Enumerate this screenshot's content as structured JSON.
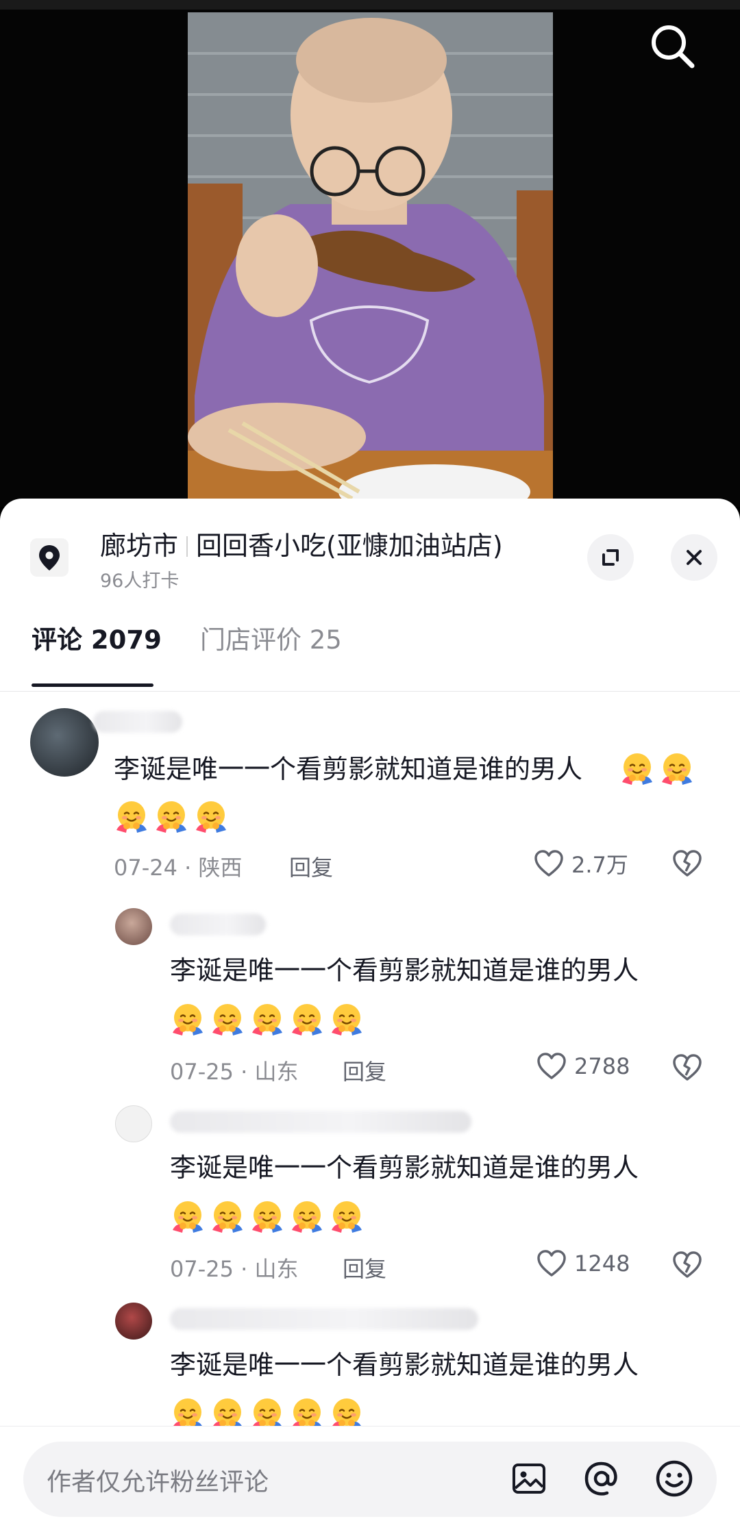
{
  "location": {
    "city": "廊坊市",
    "shop_name": "回回香小吃(亚慷加油站店)",
    "checkin_count": "96人打卡"
  },
  "tabs": [
    {
      "label": "评论 2079",
      "active": true
    },
    {
      "label": "门店评价 25",
      "active": false
    }
  ],
  "comments": [
    {
      "text_line1": "李诞是唯一一个看剪影就知道是谁的男人",
      "date": "07-24 · 陕西",
      "reply_label": "回复",
      "likes": "2.7万",
      "emoji_count": 5
    },
    {
      "text_line1": "李诞是唯一一个看剪影就知道是谁的男人",
      "date": "07-25 · 山东",
      "reply_label": "回复",
      "likes": "2788",
      "emoji_count": 5
    },
    {
      "text_line1": "李诞是唯一一个看剪影就知道是谁的男人",
      "date": "07-25 · 山东",
      "reply_label": "回复",
      "likes": "1248",
      "emoji_count": 5
    },
    {
      "text_line1": "李诞是唯一一个看剪影就知道是谁的男人",
      "emoji_count": 5
    }
  ],
  "input": {
    "placeholder": "作者仅允许粉丝评论"
  },
  "colors": {
    "text_primary": "#161823",
    "text_secondary": "#8a8b91",
    "sheet_bg": "#ffffff",
    "shirt_purple": "#8b6bb0"
  },
  "icons": [
    "search-icon",
    "location-pin-icon",
    "expand-icon",
    "close-icon",
    "heart-icon",
    "broken-heart-icon",
    "image-icon",
    "at-icon",
    "emoji-icon",
    "hug-emoji"
  ]
}
